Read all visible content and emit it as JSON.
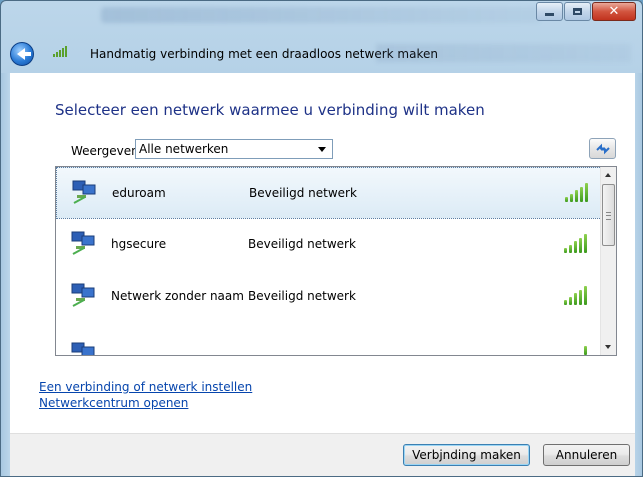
{
  "window": {
    "nav_title": "Handmatig verbinding met een draadloos netwerk maken"
  },
  "icons": {
    "back": "back-arrow-icon",
    "signal_small": "wireless-signal-icon",
    "refresh": "refresh-icon",
    "network": "network-computer-icon"
  },
  "main": {
    "heading": "Selecteer een netwerk waarmee u verbinding wilt maken",
    "show_label": "Weergeven:",
    "show_value": "Alle netwerken"
  },
  "networks": [
    {
      "name": "eduroam",
      "security": "Beveiligd netwerk",
      "signal": "5/5",
      "selected": true
    },
    {
      "name": "hgsecure",
      "security": "Beveiligd netwerk",
      "signal": "5/5",
      "selected": false
    },
    {
      "name": "Netwerk zonder naam",
      "security": "Beveiligd netwerk",
      "signal": "5/5",
      "selected": false
    }
  ],
  "links": {
    "setup": "Een verbinding of netwerk instellen",
    "center": "Netwerkcentrum openen"
  },
  "buttons": {
    "connect": "Verbjnding maken",
    "cancel": "Annuleren"
  },
  "colors": {
    "heading": "#1e3287",
    "link": "#0645ad",
    "signal": "#3c9a1d",
    "close_button": "#c1331e"
  }
}
